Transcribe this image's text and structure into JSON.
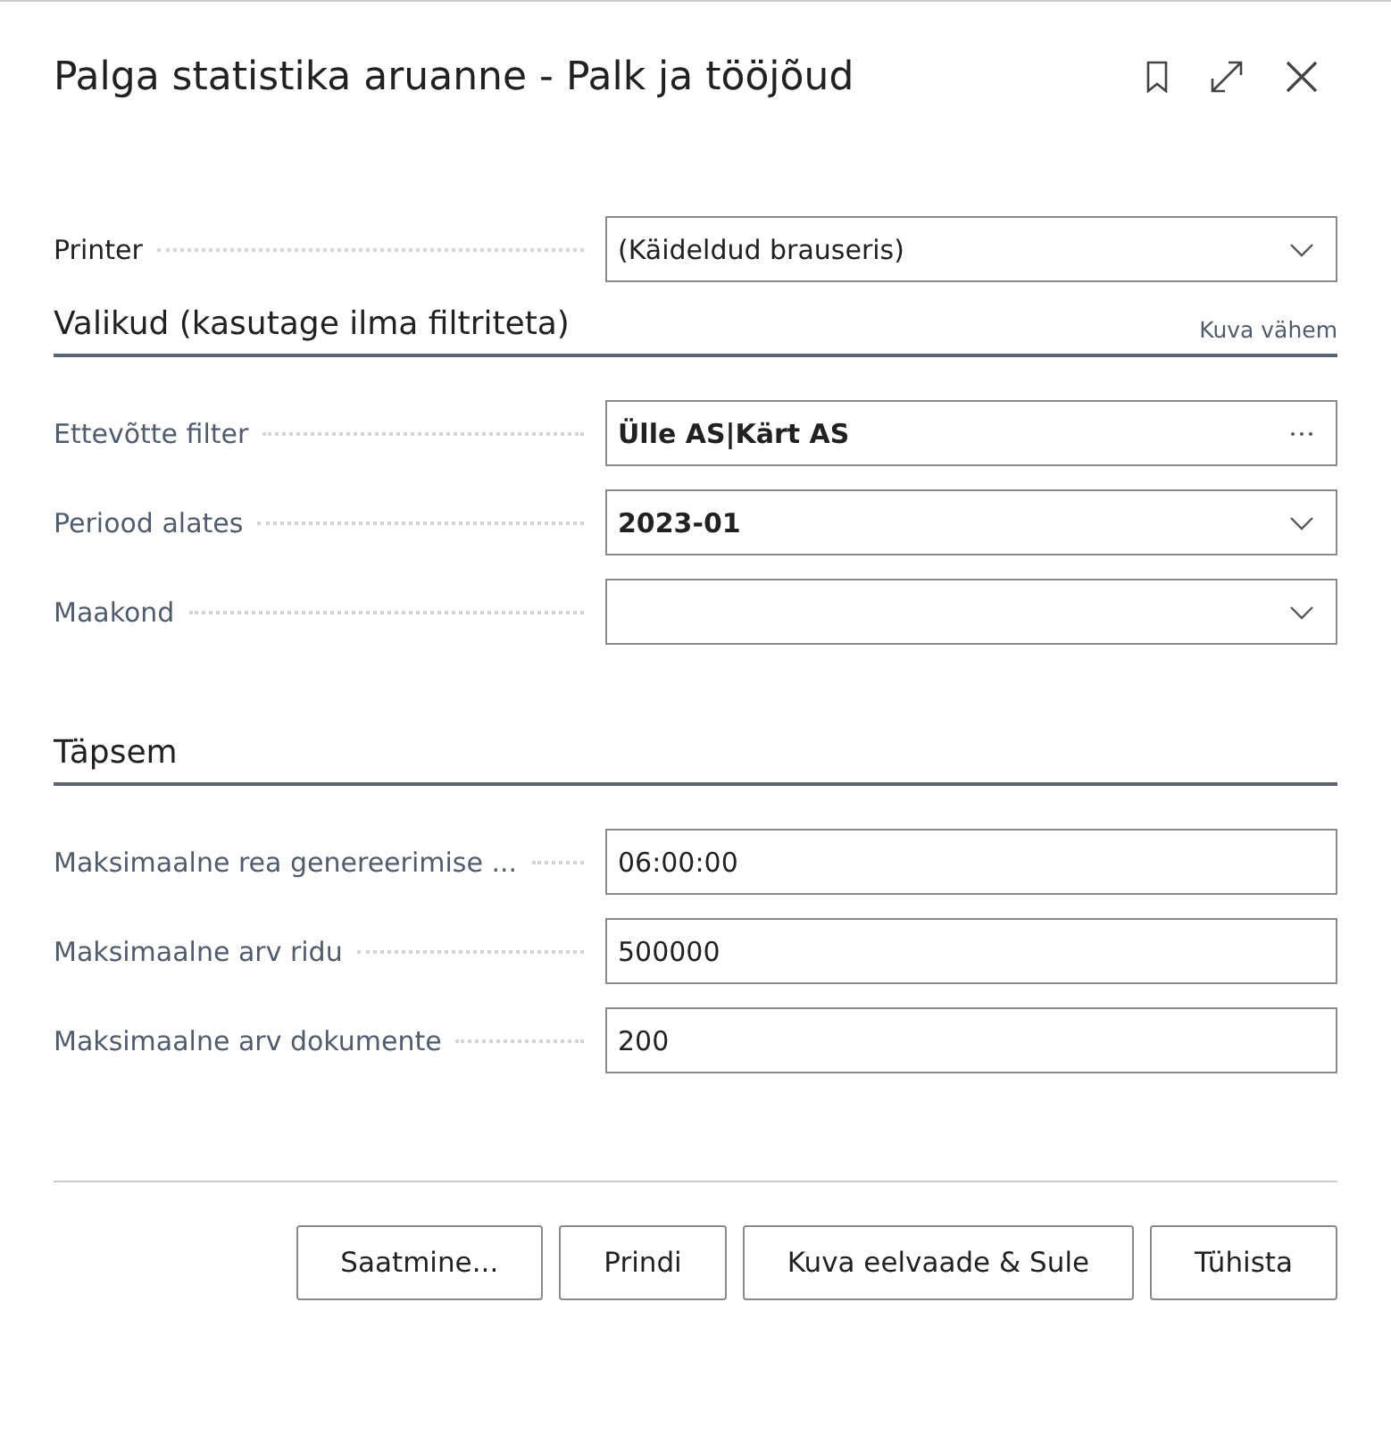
{
  "window": {
    "title": "Palga statistika aruanne - Palk ja tööjõud",
    "actions": [
      {
        "kind": "bookmark"
      },
      {
        "kind": "expand"
      },
      {
        "kind": "close"
      }
    ]
  },
  "top_fields": [
    {
      "label": "Printer",
      "muted": false,
      "kind": "dropdown",
      "value": "(Käideldud brauseris)",
      "bold": false
    }
  ],
  "sections": [
    {
      "title": "Valikud (kasutage ilma filtriteta)",
      "link": "Kuva vähem",
      "fields": [
        {
          "label": "Ettevõtte filter",
          "muted": true,
          "kind": "lookup",
          "value": "Ülle AS|Kärt AS",
          "bold": true
        },
        {
          "label": "Periood alates",
          "muted": true,
          "kind": "dropdown",
          "value": "2023-01",
          "bold": true
        },
        {
          "label": "Maakond",
          "muted": true,
          "kind": "dropdown"
        }
      ]
    },
    {
      "title": "Täpsem",
      "fields": [
        {
          "label": "Maksimaalne rea genereerimise ...",
          "muted": true,
          "kind": "text",
          "value": "06:00:00",
          "bold": false
        },
        {
          "label": "Maksimaalne arv ridu",
          "muted": true,
          "kind": "text",
          "value": "500000",
          "bold": false
        },
        {
          "label": "Maksimaalne arv dokumente",
          "muted": true,
          "kind": "text",
          "value": "200",
          "bold": false
        }
      ]
    }
  ],
  "buttons": [
    "Saatmine...",
    "Prindi",
    "Kuva eelvaade & Sule",
    "Tühista"
  ]
}
